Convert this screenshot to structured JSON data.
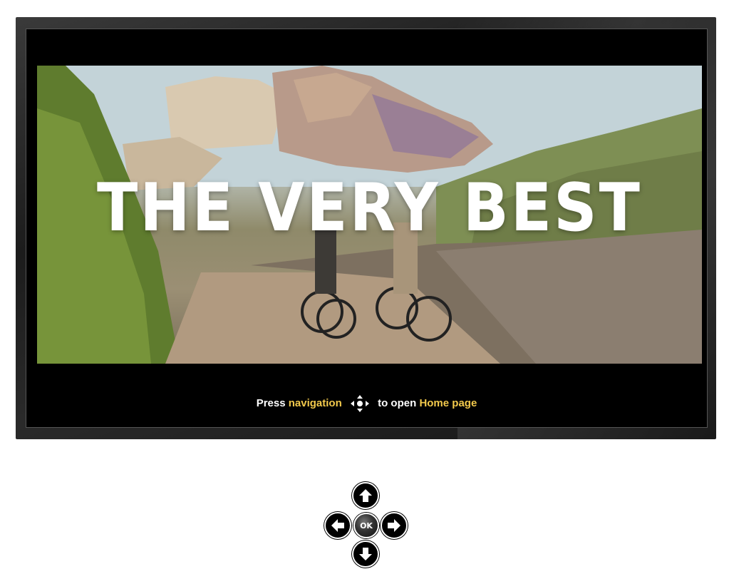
{
  "video": {
    "headline": "THE VERY BEST"
  },
  "hint": {
    "press": "Press",
    "navigation": "navigation",
    "to_open": "to open",
    "home_page": "Home page"
  },
  "remote": {
    "ok_label": "OK",
    "buttons": [
      "up",
      "left",
      "ok",
      "right",
      "down"
    ]
  },
  "colors": {
    "highlight": "#f2c94c",
    "screen": "#000000",
    "bezel": "#2a2a2a"
  }
}
